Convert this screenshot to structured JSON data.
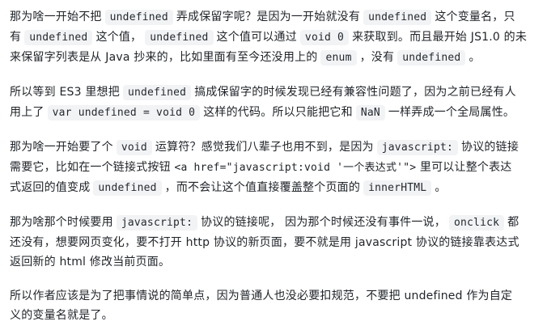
{
  "article": {
    "p1": {
      "l1": {
        "t1": "那为啥一开始不把",
        "c1": "undefined",
        "t2": "弄成保留字呢？是因为一开始就没有",
        "c2": "undefined",
        "t3": "这个变量名，只"
      },
      "l2": {
        "t1": "有",
        "c1": "undefined",
        "t2": "这个值，",
        "c2": "undefined",
        "t3": "这个值可以通过",
        "c3": "void 0",
        "t4": "来获取到。而且最开始 JS1.0 的未"
      },
      "l3": {
        "t1": "来保留字列表是从 Java 抄来的，比如里面有至今还没用上的",
        "c1": "enum",
        "t2": "，没有",
        "c2": "undefined",
        "t3": "。"
      }
    },
    "p2": {
      "l1": {
        "t1": "所以等到 ES3 里想把",
        "c1": "undefined",
        "t2": "搞成保留字的时候发现已经有兼容性问题了，因为之前已经有人"
      },
      "l2": {
        "t1": "用上了",
        "c1": "var undefined = void 0",
        "t2": "这样的代码。所以只能把它和",
        "c2": "NaN",
        "t3": "一样弄成一个全局属性。"
      }
    },
    "p3": {
      "l1": {
        "t1": "那为啥一开始要了个",
        "c1": "void",
        "t2": "运算符？感觉我们八辈子也用不到，是因为",
        "c2": "javascript:",
        "t3": "协议的链接"
      },
      "l2": {
        "t1": "需要它，比如在一个链接式按钮",
        "p1": "<a href=\"javascript:void '一个表达式'\">",
        "t2": "里可以让整个表达"
      },
      "l3": {
        "t1": "式返回的值变成",
        "c1": "undefined",
        "t2": "，而不会让这个值直接覆盖整个页面的",
        "c2": "innerHTML",
        "t3": "。"
      }
    },
    "p4": {
      "l1": {
        "t1": "那为啥那个时候要用",
        "c1": "javascript:",
        "t2": "协议的链接呢， 因为那个时候还没有事件一说，",
        "c2": "onclick",
        "t3": "都"
      },
      "l2": {
        "t1": "还没有，想要网页变化，要不打开 http 协议的新页面，要不就是用 javascript 协议的链接靠表达式"
      },
      "l3": {
        "t1": "返回新的 html 修改当前页面。"
      }
    },
    "p5": {
      "l1": {
        "t1": "所以作者应该是为了把事情说的简单点，因为普通人也没必要扣规范，不要把 undefined 作为自定"
      },
      "l2": {
        "t1": "义的变量名就是了。"
      }
    }
  }
}
